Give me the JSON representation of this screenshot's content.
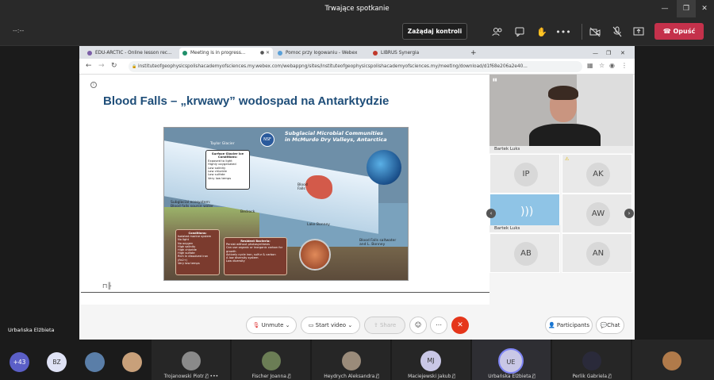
{
  "window": {
    "title": "Trwające spotkanie"
  },
  "toolbar": {
    "timer": "--:--",
    "request_control": "Zażądaj kontroli",
    "leave": "Opuść"
  },
  "browser": {
    "tabs": [
      {
        "label": "EDU-ARCTIC - Online lesson rec...",
        "color": "#7b5ea7"
      },
      {
        "label": "Meeting is in progress...",
        "color": "#1f8f6a"
      },
      {
        "label": "Pomoc przy logowaniu - Webex",
        "color": "#5aa0d8"
      },
      {
        "label": "LIBRUS Synergia",
        "color": "#c0392b"
      }
    ],
    "url": "instituteofgeophysicspolishacademyofsciences.my.webex.com/webappng/sites/instituteofgeophysicspolishacademyofsciences.my/meeting/download/d1f68e206a2e40..."
  },
  "slide": {
    "title": "Blood Falls – „krwawy” wodospad na Antarktydzie",
    "image": {
      "title_line1": "Subglacial Microbial Communities",
      "title_line2": "in McMurdo Dry Valleys, Antarctica",
      "nsf": "NSF",
      "taylor_glacier": "Taylor Glacier",
      "box1_title": "Surface Glacier Ice Conditions:",
      "box1_lines": [
        "Exposed to light",
        "Highly oxygenated",
        "Low salinity",
        "Low chloride",
        "Low sulfate",
        "Very low temps"
      ],
      "blood_falls": "Blood Falls",
      "subglacial": "Subglacial ecosystem: Blood falls source water",
      "bedrock": "Bedrock",
      "lake": "Lake Bonney",
      "blood_falls_outflow": "Blood Falls saltwater and L. Bonney",
      "box2_title": "Conditions:",
      "box2_lines": [
        "Isolated marine system",
        "No light",
        "No oxygen",
        "High salinity",
        "High chloride",
        "High sulfate",
        "Rich in dissolved iron (Fe2+)",
        "Very low temps"
      ],
      "box3_title": "Resident Bacteria:",
      "box3_lines": [
        "Persist without photosynthesis",
        "Can use organic or inorganic carbon for growth",
        "Actively cycle iron, sulfur & carbon",
        "A low diversity system",
        "Low diversity"
      ]
    }
  },
  "participants_tiles": {
    "speaker": "Bartek Luks",
    "grid": [
      "IP",
      "AK",
      "AW",
      "AB",
      "AN"
    ],
    "active_name": "Bartek Luks"
  },
  "webex_controls": {
    "unmute": "Unmute",
    "start_video": "Start video",
    "share": "Share",
    "participants": "Participants",
    "chat": "Chat"
  },
  "sharer_name": "Urbańska Elżbieta",
  "bottom_bar": {
    "extra_count": "+43",
    "avatars": [
      "BZ"
    ],
    "people": [
      {
        "name": "Trojanowski Piotr",
        "type": "photo"
      },
      {
        "name": "Fischer Joanna",
        "type": "photo"
      },
      {
        "name": "Heydrych Aleksandra",
        "type": "photo"
      },
      {
        "name": "Maciejewski Jakub",
        "type": "initials",
        "initials": "MJ"
      },
      {
        "name": "Urbańska Elżbieta",
        "type": "initials",
        "initials": "UE"
      },
      {
        "name": "Perlik Gabriela",
        "type": "photo"
      },
      {
        "name": "",
        "type": "photo"
      }
    ]
  }
}
